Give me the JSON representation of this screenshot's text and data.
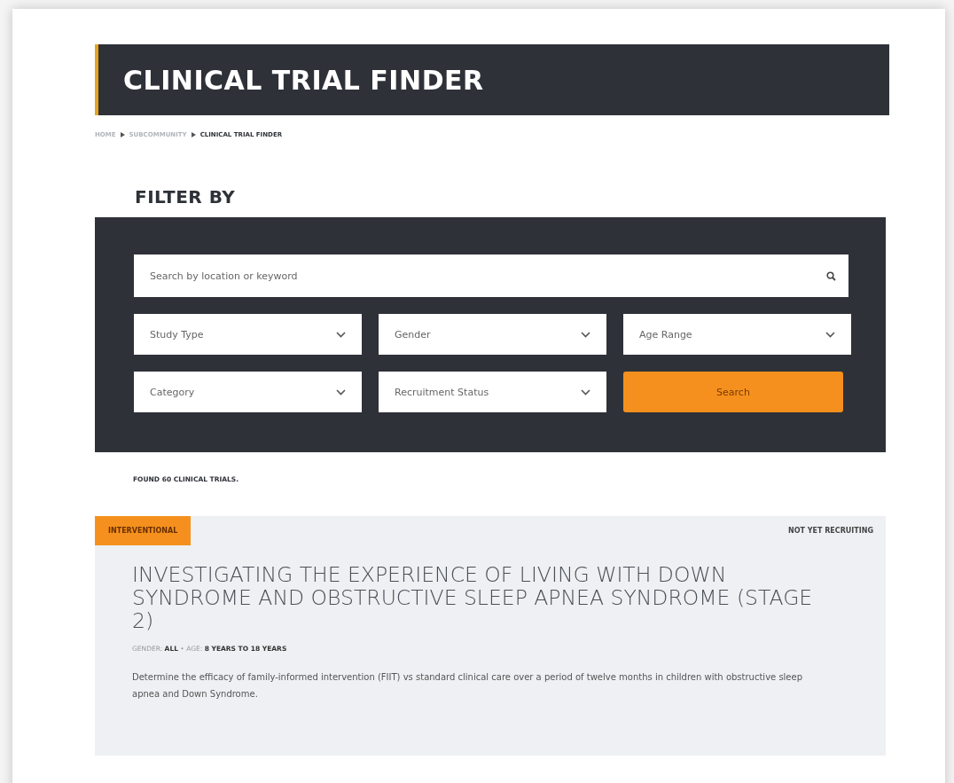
{
  "header": {
    "title": "CLINICAL TRIAL FINDER"
  },
  "breadcrumb": [
    {
      "label": "HOME",
      "current": false
    },
    {
      "label": "SUBCOMMUNITY",
      "current": false
    },
    {
      "label": "CLINICAL TRIAL FINDER",
      "current": true
    }
  ],
  "filter": {
    "heading": "FILTER BY",
    "search": {
      "placeholder": "Search by location or keyword"
    },
    "selects": [
      {
        "placeholder": "Study Type"
      },
      {
        "placeholder": "Gender"
      },
      {
        "placeholder": "Age Range"
      },
      {
        "placeholder": "Category"
      },
      {
        "placeholder": "Recruitment Status"
      }
    ],
    "button": "Search"
  },
  "results_count": "FOUND 60 CLINICAL TRIALS.",
  "trials": [
    {
      "type": "INTERVENTIONAL",
      "status": "NOT YET RECRUITING",
      "title": "INVESTIGATING THE EXPERIENCE OF LIVING WITH DOWN SYNDROME AND OBSTRUCTIVE SLEEP APNEA SYNDROME (STAGE 2)",
      "gender_label": "GENDER:",
      "gender": "ALL",
      "separator": "•",
      "age_label": "AGE:",
      "age": "8 YEARS TO 18 YEARS",
      "description": "Determine the efficacy of family-informed intervention (FIIT) vs standard clinical care over a period of twelve months in children with obstructive sleep apnea and Down Syndrome."
    }
  ]
}
